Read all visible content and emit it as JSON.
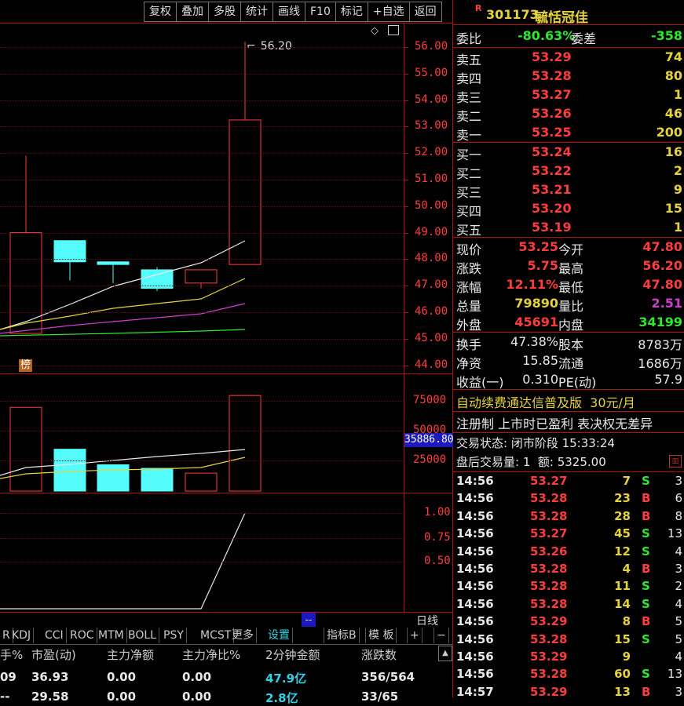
{
  "toolbar": {
    "buttons": [
      "复权",
      "叠加",
      "多股",
      "统计",
      "画线",
      "F10",
      "标记",
      "+自选",
      "返回"
    ]
  },
  "stock": {
    "badge": "R",
    "code": "301173",
    "name": "毓恬冠佳"
  },
  "chart": {
    "price_axis": [
      "56.00",
      "55.00",
      "54.00",
      "53.00",
      "52.00",
      "51.00",
      "50.00",
      "49.00",
      "48.00",
      "47.00",
      "46.00",
      "45.00",
      "44.00"
    ],
    "high_label": "56.20",
    "marker": "榜",
    "volume_axis": [
      "75000",
      "50000",
      "25000"
    ],
    "volume_readout": "35886.80",
    "indicator_axis": [
      "1.00",
      "0.75",
      "0.50"
    ],
    "period": "日线",
    "blue_box": "--"
  },
  "chart_data": {
    "type": "candlestick",
    "candles": [
      {
        "open": 45.2,
        "close": 49.0,
        "high": 51.9,
        "low": 45.2,
        "color": "red"
      },
      {
        "open": 48.7,
        "close": 47.9,
        "high": 48.7,
        "low": 47.2,
        "color": "cyan"
      },
      {
        "open": 47.9,
        "close": 47.8,
        "high": 47.9,
        "low": 47.1,
        "color": "cyan"
      },
      {
        "open": 47.6,
        "close": 46.9,
        "high": 47.7,
        "low": 46.8,
        "color": "cyan"
      },
      {
        "open": 47.1,
        "close": 47.6,
        "high": 47.6,
        "low": 46.9,
        "color": "red"
      },
      {
        "open": 47.8,
        "close": 53.25,
        "high": 56.2,
        "low": 47.8,
        "color": "red"
      }
    ],
    "volumes": [
      70000,
      35000,
      22000,
      19000,
      15000,
      79890
    ],
    "ylim": [
      43.5,
      56.5
    ]
  },
  "quote": {
    "weibi_label": "委比",
    "weibi": "-80.63%",
    "weicha_label": "委差",
    "weicha": "-358",
    "sell": [
      {
        "label": "卖五",
        "price": "53.29",
        "vol": "74"
      },
      {
        "label": "卖四",
        "price": "53.28",
        "vol": "80"
      },
      {
        "label": "卖三",
        "price": "53.27",
        "vol": "1"
      },
      {
        "label": "卖二",
        "price": "53.26",
        "vol": "46"
      },
      {
        "label": "卖一",
        "price": "53.25",
        "vol": "200"
      }
    ],
    "buy": [
      {
        "label": "买一",
        "price": "53.24",
        "vol": "16"
      },
      {
        "label": "买二",
        "price": "53.22",
        "vol": "2"
      },
      {
        "label": "买三",
        "price": "53.21",
        "vol": "9"
      },
      {
        "label": "买四",
        "price": "53.20",
        "vol": "15"
      },
      {
        "label": "买五",
        "price": "53.19",
        "vol": "1"
      }
    ],
    "stats": [
      {
        "l1": "现价",
        "v1": "53.25",
        "c1": "red",
        "l2": "今开",
        "v2": "47.80",
        "c2": "red"
      },
      {
        "l1": "涨跌",
        "v1": "5.75",
        "c1": "red",
        "l2": "最高",
        "v2": "56.20",
        "c2": "red"
      },
      {
        "l1": "涨幅",
        "v1": "12.11%",
        "c1": "red",
        "l2": "最低",
        "v2": "47.80",
        "c2": "red"
      },
      {
        "l1": "总量",
        "v1": "79890",
        "c1": "yellow",
        "l2": "量比",
        "v2": "2.51",
        "c2": "magenta"
      },
      {
        "l1": "外盘",
        "v1": "45691",
        "c1": "red",
        "l2": "内盘",
        "v2": "34199",
        "c2": "green"
      }
    ],
    "stats2": [
      {
        "l1": "换手",
        "v1": "47.38%",
        "l2": "股本",
        "v2": "8783万"
      },
      {
        "l1": "净资",
        "v1": "15.85",
        "l2": "流通",
        "v2": "1686万"
      },
      {
        "l1": "收益(一)",
        "v1": "0.310",
        "l2": "PE(动)",
        "v2": "57.9"
      }
    ],
    "promo": "自动续费通达信普及版  30元/月",
    "reg": "注册制 上市时已盈利 表决权无差异",
    "trade_status": "交易状态: 闭市阶段 15:33:24",
    "after_hours": "盘后交易量: 1  额: 5325.00"
  },
  "ticks": [
    {
      "t": "14:56",
      "p": "53.27",
      "v": "7",
      "s": "S",
      "n": "3"
    },
    {
      "t": "14:56",
      "p": "53.28",
      "v": "23",
      "s": "B",
      "n": "6"
    },
    {
      "t": "14:56",
      "p": "53.28",
      "v": "28",
      "s": "B",
      "n": "8"
    },
    {
      "t": "14:56",
      "p": "53.27",
      "v": "45",
      "s": "S",
      "n": "13"
    },
    {
      "t": "14:56",
      "p": "53.26",
      "v": "12",
      "s": "S",
      "n": "4"
    },
    {
      "t": "14:56",
      "p": "53.28",
      "v": "4",
      "s": "B",
      "n": "3"
    },
    {
      "t": "14:56",
      "p": "53.28",
      "v": "11",
      "s": "S",
      "n": "2"
    },
    {
      "t": "14:56",
      "p": "53.28",
      "v": "14",
      "s": "S",
      "n": "4"
    },
    {
      "t": "14:56",
      "p": "53.29",
      "v": "8",
      "s": "B",
      "n": "5"
    },
    {
      "t": "14:56",
      "p": "53.28",
      "v": "15",
      "s": "S",
      "n": "5"
    },
    {
      "t": "14:56",
      "p": "53.29",
      "v": "9",
      "s": "",
      "n": "4"
    },
    {
      "t": "14:56",
      "p": "53.28",
      "v": "60",
      "s": "S",
      "n": "13"
    },
    {
      "t": "14:57",
      "p": "53.29",
      "v": "13",
      "s": "B",
      "n": "3"
    }
  ],
  "indicator_tabs": [
    "R",
    "KDJ",
    "CCI",
    "ROC",
    "MTM",
    "BOLL",
    "PSY",
    "MCST",
    "更多",
    "设置"
  ],
  "indicator_tabs_right": [
    "指标B",
    "模 板",
    "+",
    "−"
  ],
  "bottom_table": {
    "headers": [
      "手%",
      "市盈(动)",
      "主力净额",
      "主力净比%",
      "2分钟金额",
      "涨跌数"
    ],
    "row1": [
      "09",
      "36.93",
      "0.00",
      "0.00",
      "47.9亿",
      "356/564"
    ],
    "row2": [
      "--",
      "29.58",
      "0.00",
      "0.00",
      "2.8亿",
      "33/65"
    ]
  }
}
